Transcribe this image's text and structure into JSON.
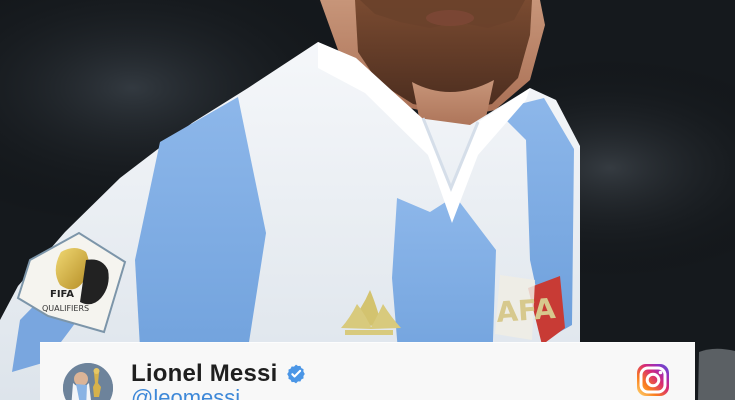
{
  "post": {
    "display_name": "Lionel Messi",
    "handle": "@leomessi"
  },
  "icons": {
    "verified": "verified-icon",
    "platform": "instagram-icon"
  },
  "colors": {
    "card_background": "#f8f8f8",
    "verified_blue": "#4b96e6",
    "handle_blue": "#3e88d8",
    "instagram_gradient_start": "#feda75",
    "instagram_gradient_mid": "#d62976",
    "instagram_gradient_end": "#4f5bd5"
  }
}
